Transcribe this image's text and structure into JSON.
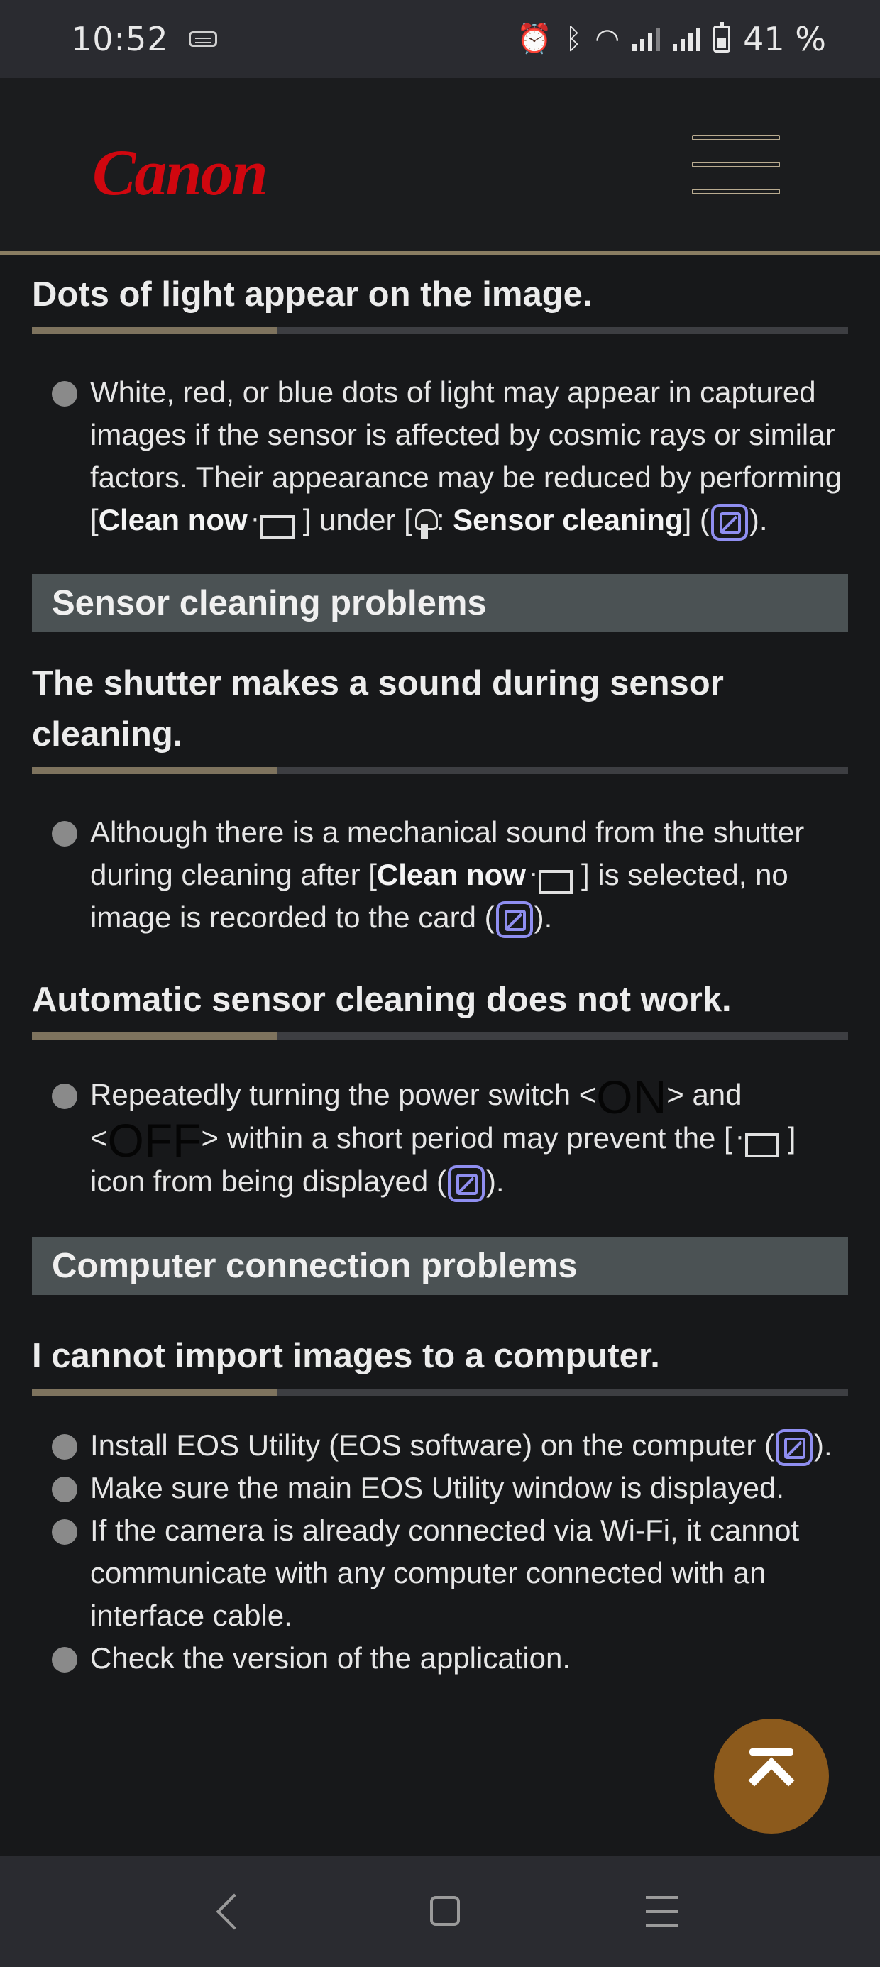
{
  "status_bar": {
    "time": "10:52",
    "battery": "41 %"
  },
  "header": {
    "logo": "Canon"
  },
  "sections": {
    "dots": {
      "title": "Dots of light appear on the image.",
      "text1": "White, red, or blue dots of light may appear in captured images if the sensor is affected by cosmic rays or similar factors. Their appearance may be reduced by performing [",
      "bold1": "Clean now",
      "text2": "] under [",
      "text3": ":",
      "bold2": "Sensor cleaning",
      "text4": "] (",
      "text5": ")."
    },
    "sensor_band": "Sensor cleaning problems",
    "shutter": {
      "title": "The shutter makes a sound during sensor cleaning.",
      "text1": "Although there is a mechanical sound from the shutter during cleaning after [",
      "bold1": "Clean now",
      "text2": "] is selected, no image is recorded to the card (",
      "text3": ")."
    },
    "auto": {
      "title": "Automatic sensor cleaning does not work.",
      "text1": "Repeatedly turning the power switch <",
      "on": "ON",
      "text2": "> and <",
      "off": "OFF",
      "text3": "> within a short period may prevent the [",
      "text4": "] icon from being displayed (",
      "text5": ")."
    },
    "computer_band": "Computer connection problems",
    "import": {
      "title": "I cannot import images to a computer.",
      "item1_a": "Install EOS Utility (EOS software) on the computer (",
      "item1_b": ").",
      "item2": "Make sure the main EOS Utility window is displayed.",
      "item3": "If the camera is already connected via Wi-Fi, it cannot communicate with any computer connected with an interface cable.",
      "item4": "Check the version of the application."
    }
  }
}
